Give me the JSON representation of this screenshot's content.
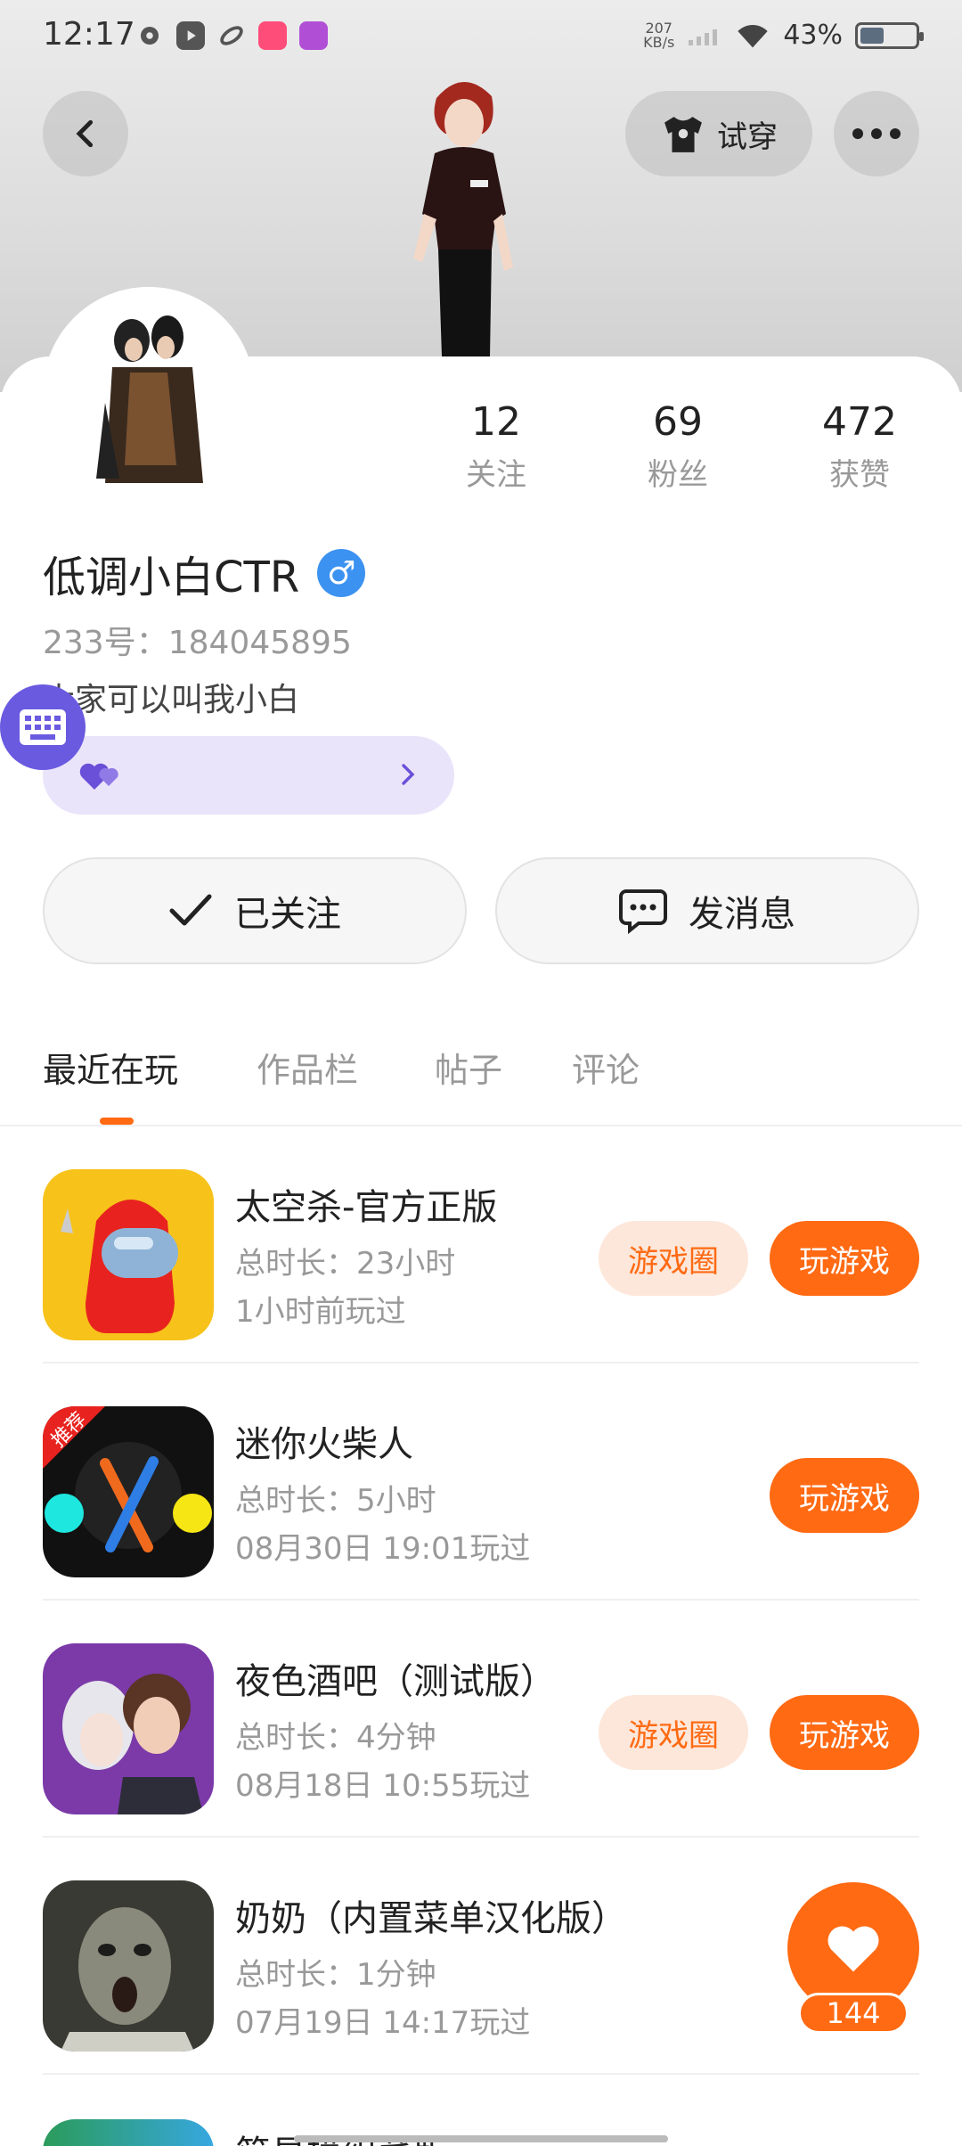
{
  "status_bar": {
    "time": "12:17",
    "net_speed_value": "207",
    "net_speed_unit": "KB/s",
    "battery_percent": "43%",
    "battery_level": 0.43
  },
  "header": {
    "tryon_label": "试穿"
  },
  "profile": {
    "stats": [
      {
        "value": "12",
        "label": "关注"
      },
      {
        "value": "69",
        "label": "粉丝"
      },
      {
        "value": "472",
        "label": "获赞"
      }
    ],
    "name": "低调小白CTR",
    "gender_symbol": "♂",
    "uid": "233号：184045895",
    "bio": "大家可以叫我小白"
  },
  "actions": {
    "follow_label": "已关注",
    "message_label": "发消息"
  },
  "tabs": [
    "最近在玩",
    "作品栏",
    "帖子",
    "评论"
  ],
  "games": [
    {
      "title": "太空杀-官方正版",
      "duration": "总时长：23小时",
      "last_played": "1小时前玩过",
      "circle_label": "游戏圈",
      "play_label": "玩游戏"
    },
    {
      "title": "迷你火柴人",
      "duration": "总时长：5小时",
      "last_played": "08月30日  19:01玩过",
      "badge": "推荐",
      "play_label": "玩游戏"
    },
    {
      "title": "夜色酒吧（测试版）",
      "duration": "总时长：4分钟",
      "last_played": "08月18日  10:55玩过",
      "circle_label": "游戏圈",
      "play_label": "玩游戏"
    },
    {
      "title": "奶奶（内置菜单汉化版）",
      "duration": "总时长：1分钟",
      "last_played": "07月19日  14:17玩过"
    }
  ],
  "partial_game": {
    "title": "简易模组菜版"
  },
  "like_float": {
    "count": "144"
  },
  "colors": {
    "accent": "#ff6a13",
    "accent_light": "#fde7da",
    "gender_blue": "#3c92f0",
    "purple": "#6a5ae0"
  }
}
